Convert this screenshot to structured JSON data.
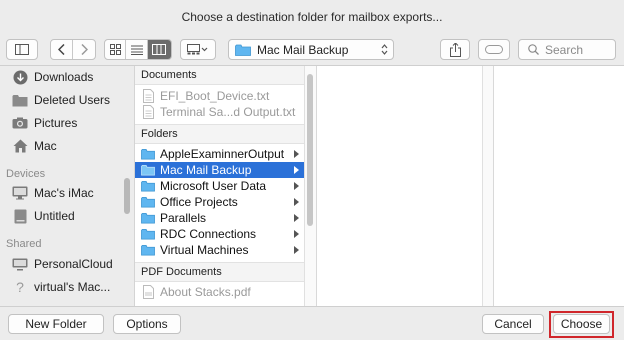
{
  "dialog": {
    "title": "Choose a destination folder for mailbox exports..."
  },
  "toolbar": {
    "location": "Mac Mail Backup",
    "search_placeholder": "Search",
    "icons": [
      "sidebar-icon",
      "back-icon",
      "forward-icon",
      "icon-view-icon",
      "list-view-icon",
      "column-view-icon",
      "gallery-view-icon",
      "share-icon",
      "tag-icon",
      "search-icon"
    ]
  },
  "sidebar": {
    "favorites": [
      {
        "label": "Downloads",
        "icon": "download-icon"
      },
      {
        "label": "Deleted Users",
        "icon": "folder-icon"
      },
      {
        "label": "Pictures",
        "icon": "camera-icon"
      },
      {
        "label": "Mac",
        "icon": "home-icon"
      }
    ],
    "devices_header": "Devices",
    "devices": [
      {
        "label": "Mac's iMac",
        "icon": "imac-icon"
      },
      {
        "label": "Untitled",
        "icon": "drive-icon"
      }
    ],
    "shared_header": "Shared",
    "shared": [
      {
        "label": "PersonalCloud",
        "icon": "display-icon"
      },
      {
        "label": "virtual's Mac...",
        "icon": "question-icon"
      }
    ]
  },
  "column1": {
    "documents_header": "Documents",
    "documents": [
      "EFI_Boot_Device.txt",
      "Terminal Sa...d Output.txt"
    ],
    "folders_header": "Folders",
    "folders": [
      {
        "label": "AppleExaminnerOutput",
        "selected": false
      },
      {
        "label": "Mac Mail Backup",
        "selected": true
      },
      {
        "label": "Microsoft User Data",
        "selected": false
      },
      {
        "label": "Office Projects",
        "selected": false
      },
      {
        "label": "Parallels",
        "selected": false
      },
      {
        "label": "RDC Connections",
        "selected": false
      },
      {
        "label": "Virtual Machines",
        "selected": false
      }
    ],
    "pdf_header": "PDF Documents",
    "pdfs": [
      "About Stacks.pdf"
    ]
  },
  "footer": {
    "new_folder": "New Folder",
    "options": "Options",
    "cancel": "Cancel",
    "choose": "Choose"
  },
  "colors": {
    "selection": "#2b71d8",
    "folder": "#5fb6f0",
    "highlight_outline": "#d0262b"
  }
}
